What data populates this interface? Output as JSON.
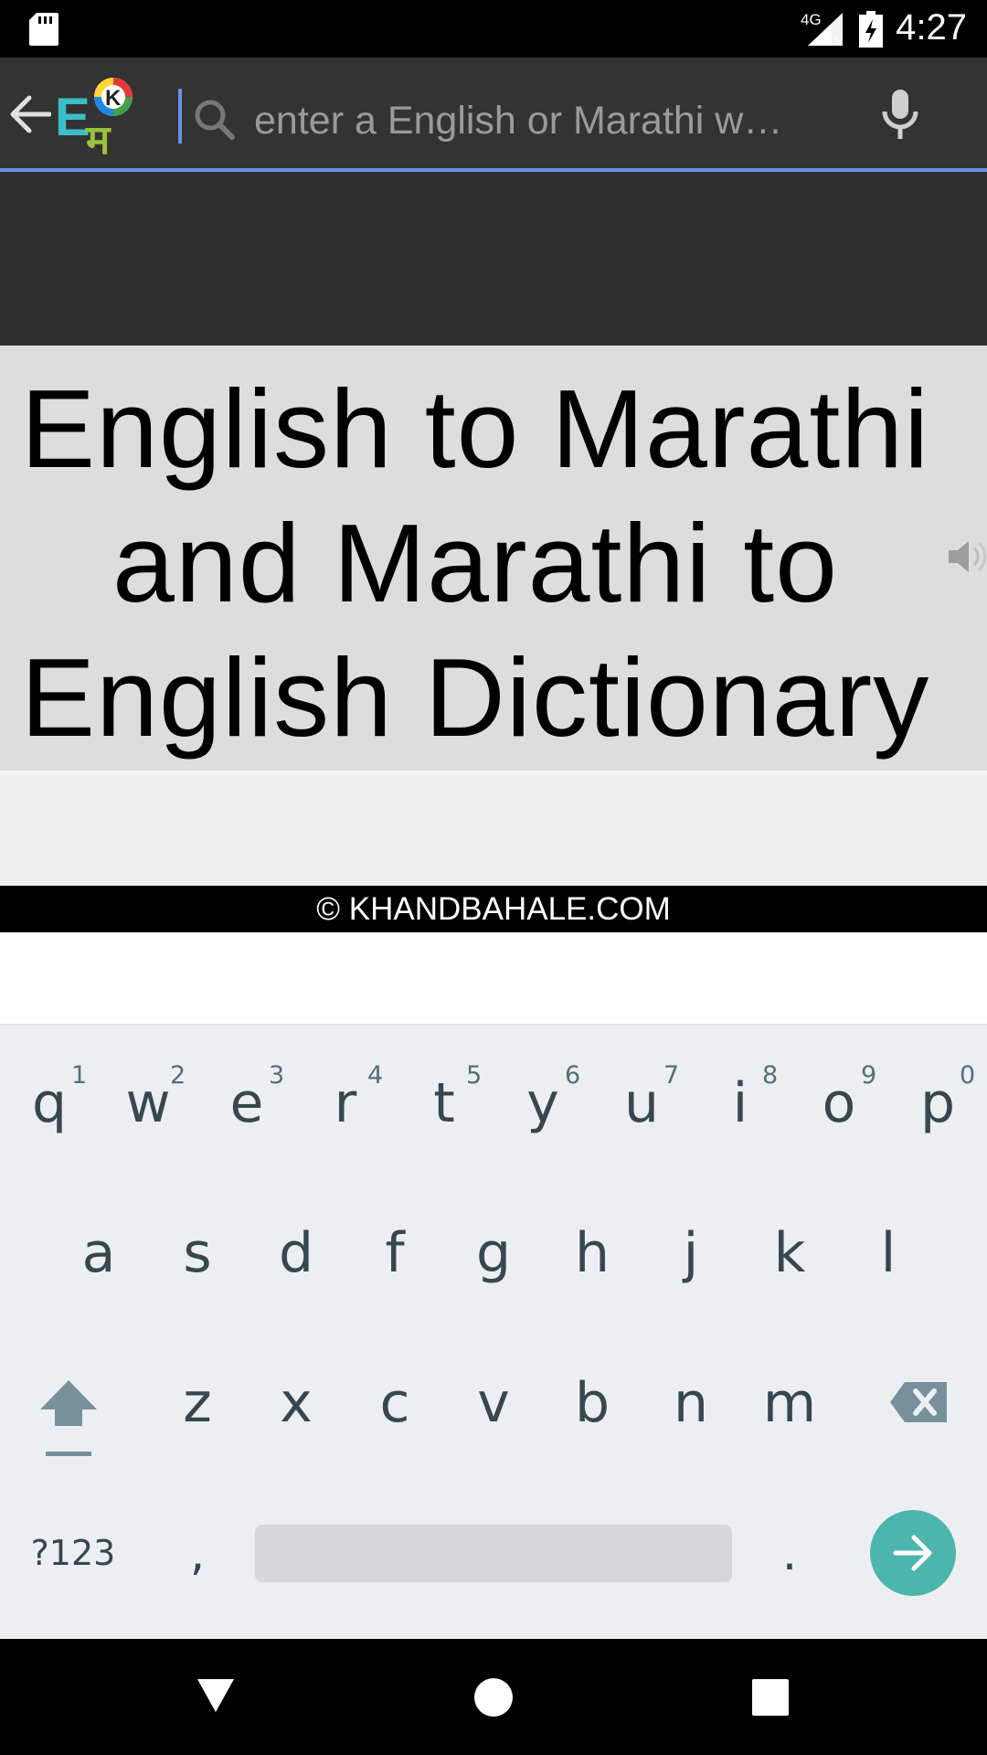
{
  "status_bar": {
    "time": "4:27",
    "network_label": "4G",
    "icons": [
      "sd-card-icon",
      "signal-icon",
      "battery-charging-icon"
    ]
  },
  "app_bar": {
    "back_icon": "arrow-left-icon",
    "logo": "khandbahale-logo",
    "search": {
      "placeholder": "enter a English or Marathi w…",
      "search_icon": "magnifier-icon",
      "mic_icon": "microphone-icon"
    }
  },
  "header": {
    "title_line1": "English to Marathi",
    "title_line2": "and Marathi to",
    "title_line3": "English Dictionary",
    "speaker_icon": "speaker-icon"
  },
  "footer": {
    "copyright": "© KHANDBAHALE.COM"
  },
  "keyboard": {
    "row1": [
      {
        "letter": "q",
        "hint": "1"
      },
      {
        "letter": "w",
        "hint": "2"
      },
      {
        "letter": "e",
        "hint": "3"
      },
      {
        "letter": "r",
        "hint": "4"
      },
      {
        "letter": "t",
        "hint": "5"
      },
      {
        "letter": "y",
        "hint": "6"
      },
      {
        "letter": "u",
        "hint": "7"
      },
      {
        "letter": "i",
        "hint": "8"
      },
      {
        "letter": "o",
        "hint": "9"
      },
      {
        "letter": "p",
        "hint": "0"
      }
    ],
    "row2": [
      "a",
      "s",
      "d",
      "f",
      "g",
      "h",
      "j",
      "k",
      "l"
    ],
    "row3": [
      "z",
      "x",
      "c",
      "v",
      "b",
      "n",
      "m"
    ],
    "row4": {
      "symbols_label": "?123",
      "comma": ",",
      "period": "."
    },
    "icons": {
      "shift": "shift-icon",
      "backspace": "backspace-icon",
      "enter": "arrow-right-icon"
    },
    "colors": {
      "enter_key": "#4db6ac",
      "background": "#eceff1"
    }
  },
  "nav_bar": {
    "icons": [
      "back-triangle-icon",
      "home-circle-icon",
      "recents-square-icon"
    ]
  }
}
